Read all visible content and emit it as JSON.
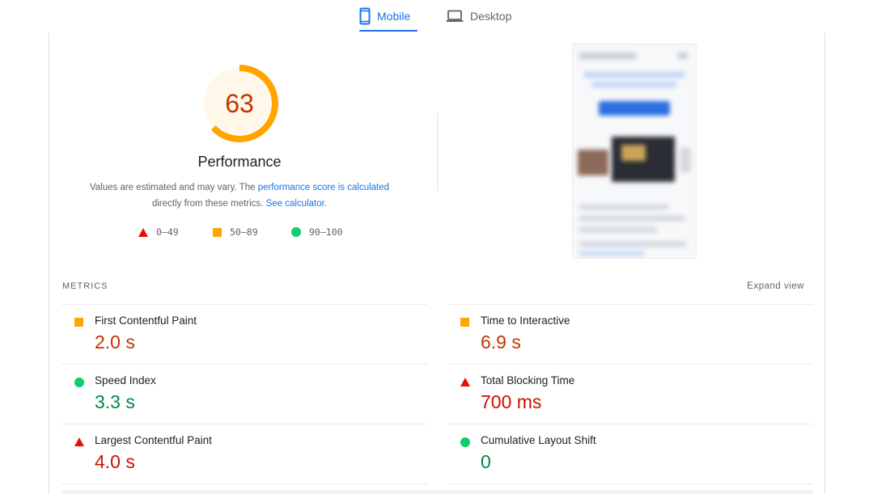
{
  "tabs": [
    {
      "label": "Mobile",
      "icon": "phone-icon",
      "active": true
    },
    {
      "label": "Desktop",
      "icon": "laptop-icon",
      "active": false
    }
  ],
  "score": {
    "value": "63",
    "fraction": 0.63,
    "color": "#ffa400",
    "text_color": "#c33300",
    "bg_color": "#fff7ea"
  },
  "performance": {
    "title": "Performance",
    "desc_part1": "Values are estimated and may vary. The ",
    "desc_link1": "performance score is calculated",
    "desc_part2": "directly from these metrics. ",
    "desc_link2": "See calculator",
    "desc_end": "."
  },
  "legend": [
    {
      "range": "0–49",
      "shape": "triangle-icon",
      "color": "#eb0f00"
    },
    {
      "range": "50–89",
      "shape": "square-icon",
      "color": "#ffa400"
    },
    {
      "range": "90–100",
      "shape": "circle-icon",
      "color": "#0cce6b"
    }
  ],
  "metrics_header": {
    "title": "METRICS",
    "expand": "Expand view"
  },
  "metrics": {
    "left": [
      {
        "name": "First Contentful Paint",
        "value": "2.0 s",
        "status": "average"
      },
      {
        "name": "Speed Index",
        "value": "3.3 s",
        "status": "pass"
      },
      {
        "name": "Largest Contentful Paint",
        "value": "4.0 s",
        "status": "fail"
      }
    ],
    "right": [
      {
        "name": "Time to Interactive",
        "value": "6.9 s",
        "status": "average"
      },
      {
        "name": "Total Blocking Time",
        "value": "700 ms",
        "status": "fail"
      },
      {
        "name": "Cumulative Layout Shift",
        "value": "0",
        "status": "pass"
      }
    ]
  },
  "colors": {
    "accent": "#1a73e8",
    "fail": "#eb0f00",
    "average": "#ffa400",
    "pass": "#0cce6b"
  }
}
